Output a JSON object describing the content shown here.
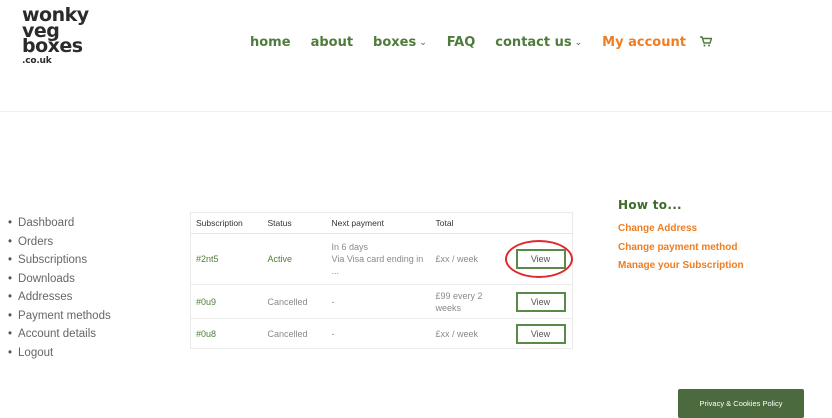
{
  "logo": {
    "line1": "wonky",
    "line2": "veg",
    "line3": "boxes",
    "line4": ".co.uk"
  },
  "nav": {
    "items": [
      {
        "label": "home"
      },
      {
        "label": "about"
      },
      {
        "label": "boxes"
      },
      {
        "label": "FAQ"
      },
      {
        "label": "contact us"
      },
      {
        "label": "My account"
      }
    ],
    "cart_icon": "shopping-cart-icon"
  },
  "account_menu": {
    "items": [
      "Dashboard",
      "Orders",
      "Subscriptions",
      "Downloads",
      "Addresses",
      "Payment methods",
      "Account details",
      "Logout"
    ]
  },
  "subscriptions_table": {
    "headers": [
      "Subscription",
      "Status",
      "Next payment",
      "Total",
      ""
    ],
    "rows": [
      {
        "id": "#2nt5",
        "status": "Active",
        "next_payment": "In 6 days",
        "payment_note": "Via Visa card ending in ...",
        "total": "£xx / week",
        "action": "View"
      },
      {
        "id": "#0u9",
        "status": "Cancelled",
        "next_payment": "-",
        "total": "£99 every 2 weeks",
        "action": "View"
      },
      {
        "id": "#0u8",
        "status": "Cancelled",
        "next_payment": "-",
        "total": "£xx / week",
        "action": "View"
      }
    ]
  },
  "howto": {
    "title": "How to...",
    "links": [
      "Change Address",
      "Change payment method",
      "Manage your Subscription"
    ]
  },
  "cookie_badge": {
    "label": "Privacy & Cookies Policy"
  },
  "colors": {
    "brand_green": "#4f7c3a",
    "accent_orange": "#ef7d22",
    "highlight_red": "#e0282e"
  }
}
